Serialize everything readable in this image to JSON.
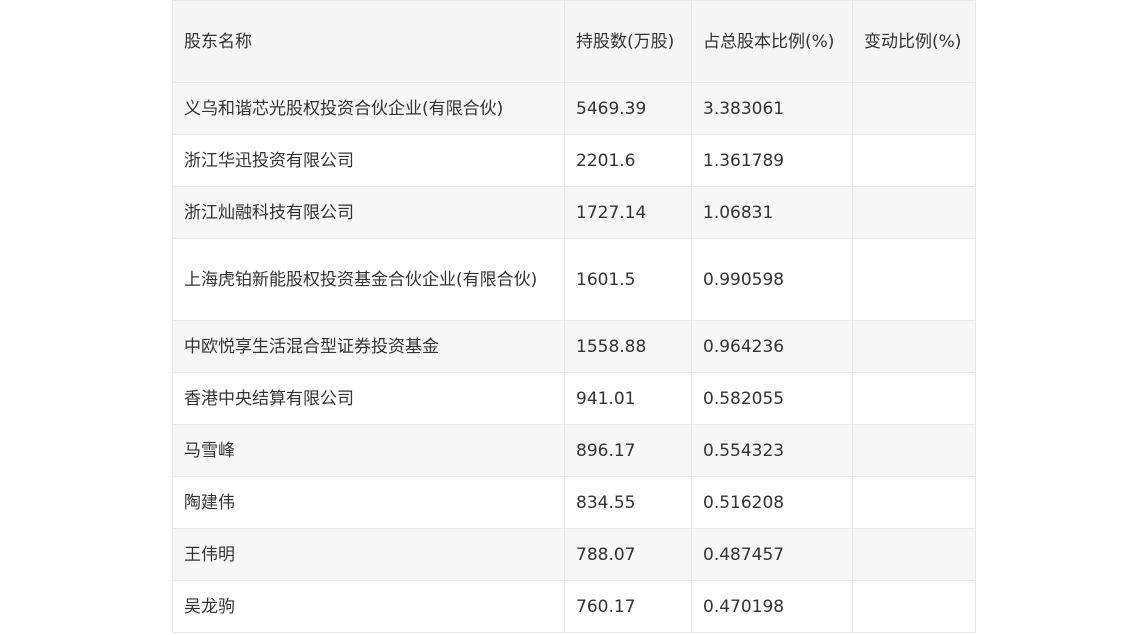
{
  "table": {
    "headers": [
      "股东名称",
      "持股数(万股)",
      "占总股本比例(%)",
      "变动比例(%)"
    ],
    "rows": [
      [
        "义乌和谐芯光股权投资合伙企业(有限合伙)",
        "5469.39",
        "3.383061",
        ""
      ],
      [
        "浙江华迅投资有限公司",
        "2201.6",
        "1.361789",
        ""
      ],
      [
        "浙江灿融科技有限公司",
        "1727.14",
        "1.06831",
        ""
      ],
      [
        "上海虎铂新能股权投资基金合伙企业(有限合伙)",
        "1601.5",
        "0.990598",
        ""
      ],
      [
        "中欧悦享生活混合型证券投资基金",
        "1558.88",
        "0.964236",
        ""
      ],
      [
        "香港中央结算有限公司",
        "941.01",
        "0.582055",
        ""
      ],
      [
        "马雪峰",
        "896.17",
        "0.554323",
        ""
      ],
      [
        "陶建伟",
        "834.55",
        "0.516208",
        ""
      ],
      [
        "王伟明",
        "788.07",
        "0.487457",
        ""
      ],
      [
        "吴龙驹",
        "760.17",
        "0.470198",
        ""
      ]
    ]
  }
}
